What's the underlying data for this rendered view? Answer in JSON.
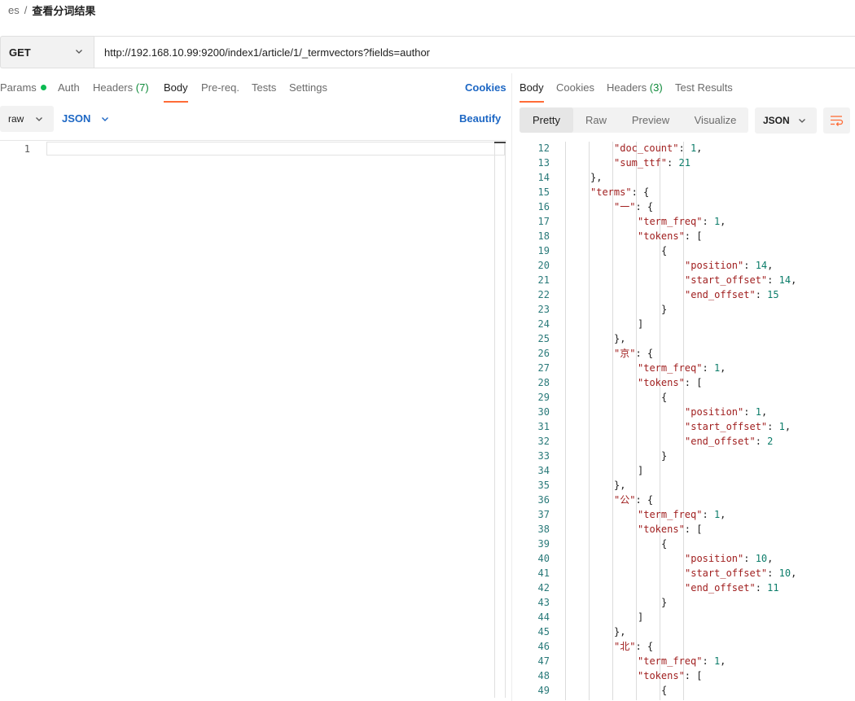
{
  "breadcrumb": {
    "parent": "es",
    "separator": "/",
    "current": "查看分词结果"
  },
  "request": {
    "method": "GET",
    "url": "http://192.168.10.99:9200/index1/article/1/_termvectors?fields=author"
  },
  "request_tabs": [
    {
      "label": "Params",
      "count": "",
      "dot": true
    },
    {
      "label": "Auth",
      "count": ""
    },
    {
      "label": "Headers",
      "count": "(7)"
    },
    {
      "label": "Body",
      "count": "",
      "active": true
    },
    {
      "label": "Pre-req.",
      "count": ""
    },
    {
      "label": "Tests",
      "count": ""
    },
    {
      "label": "Settings",
      "count": ""
    }
  ],
  "cookies_link": "Cookies",
  "body_options": {
    "mode": "raw",
    "language": "JSON",
    "beautify": "Beautify"
  },
  "editor": {
    "line_numbers": [
      "1"
    ]
  },
  "response_tabs": [
    {
      "label": "Body",
      "count": "",
      "active": true
    },
    {
      "label": "Cookies",
      "count": ""
    },
    {
      "label": "Headers",
      "count": "(3)"
    },
    {
      "label": "Test Results",
      "count": ""
    }
  ],
  "view_modes": [
    "Pretty",
    "Raw",
    "Preview",
    "Visualize"
  ],
  "active_view": "Pretty",
  "response_format": "JSON",
  "colors": {
    "accent": "#ff6c37",
    "link": "#1d67c4",
    "key": "#a01f1f",
    "number": "#0c7d6a",
    "success": "#0cbb52"
  },
  "response_lines": [
    {
      "n": "12",
      "d": 4,
      "k": "\"doc_count\"",
      "s": ": ",
      "v": "1",
      "e": ","
    },
    {
      "n": "13",
      "d": 4,
      "k": "\"sum_ttf\"",
      "s": ": ",
      "v": "21",
      "e": ""
    },
    {
      "n": "14",
      "d": 3,
      "p": "},"
    },
    {
      "n": "15",
      "d": 3,
      "k": "\"terms\"",
      "s": ": {",
      "v": "",
      "e": ""
    },
    {
      "n": "16",
      "d": 4,
      "k": "\"一\"",
      "s": ": {",
      "v": "",
      "e": ""
    },
    {
      "n": "17",
      "d": 5,
      "k": "\"term_freq\"",
      "s": ": ",
      "v": "1",
      "e": ","
    },
    {
      "n": "18",
      "d": 5,
      "k": "\"tokens\"",
      "s": ": [",
      "v": "",
      "e": ""
    },
    {
      "n": "19",
      "d": 6,
      "p": "{"
    },
    {
      "n": "20",
      "d": 7,
      "k": "\"position\"",
      "s": ": ",
      "v": "14",
      "e": ","
    },
    {
      "n": "21",
      "d": 7,
      "k": "\"start_offset\"",
      "s": ": ",
      "v": "14",
      "e": ","
    },
    {
      "n": "22",
      "d": 7,
      "k": "\"end_offset\"",
      "s": ": ",
      "v": "15",
      "e": ""
    },
    {
      "n": "23",
      "d": 6,
      "p": "}"
    },
    {
      "n": "24",
      "d": 5,
      "p": "]"
    },
    {
      "n": "25",
      "d": 4,
      "p": "},"
    },
    {
      "n": "26",
      "d": 4,
      "k": "\"京\"",
      "s": ": {",
      "v": "",
      "e": ""
    },
    {
      "n": "27",
      "d": 5,
      "k": "\"term_freq\"",
      "s": ": ",
      "v": "1",
      "e": ","
    },
    {
      "n": "28",
      "d": 5,
      "k": "\"tokens\"",
      "s": ": [",
      "v": "",
      "e": ""
    },
    {
      "n": "29",
      "d": 6,
      "p": "{"
    },
    {
      "n": "30",
      "d": 7,
      "k": "\"position\"",
      "s": ": ",
      "v": "1",
      "e": ","
    },
    {
      "n": "31",
      "d": 7,
      "k": "\"start_offset\"",
      "s": ": ",
      "v": "1",
      "e": ","
    },
    {
      "n": "32",
      "d": 7,
      "k": "\"end_offset\"",
      "s": ": ",
      "v": "2",
      "e": ""
    },
    {
      "n": "33",
      "d": 6,
      "p": "}"
    },
    {
      "n": "34",
      "d": 5,
      "p": "]"
    },
    {
      "n": "35",
      "d": 4,
      "p": "},"
    },
    {
      "n": "36",
      "d": 4,
      "k": "\"公\"",
      "s": ": {",
      "v": "",
      "e": ""
    },
    {
      "n": "37",
      "d": 5,
      "k": "\"term_freq\"",
      "s": ": ",
      "v": "1",
      "e": ","
    },
    {
      "n": "38",
      "d": 5,
      "k": "\"tokens\"",
      "s": ": [",
      "v": "",
      "e": ""
    },
    {
      "n": "39",
      "d": 6,
      "p": "{"
    },
    {
      "n": "40",
      "d": 7,
      "k": "\"position\"",
      "s": ": ",
      "v": "10",
      "e": ","
    },
    {
      "n": "41",
      "d": 7,
      "k": "\"start_offset\"",
      "s": ": ",
      "v": "10",
      "e": ","
    },
    {
      "n": "42",
      "d": 7,
      "k": "\"end_offset\"",
      "s": ": ",
      "v": "11",
      "e": ""
    },
    {
      "n": "43",
      "d": 6,
      "p": "}"
    },
    {
      "n": "44",
      "d": 5,
      "p": "]"
    },
    {
      "n": "45",
      "d": 4,
      "p": "},"
    },
    {
      "n": "46",
      "d": 4,
      "k": "\"北\"",
      "s": ": {",
      "v": "",
      "e": ""
    },
    {
      "n": "47",
      "d": 5,
      "k": "\"term_freq\"",
      "s": ": ",
      "v": "1",
      "e": ","
    },
    {
      "n": "48",
      "d": 5,
      "k": "\"tokens\"",
      "s": ": [",
      "v": "",
      "e": ""
    },
    {
      "n": "49",
      "d": 6,
      "p": "{"
    }
  ]
}
